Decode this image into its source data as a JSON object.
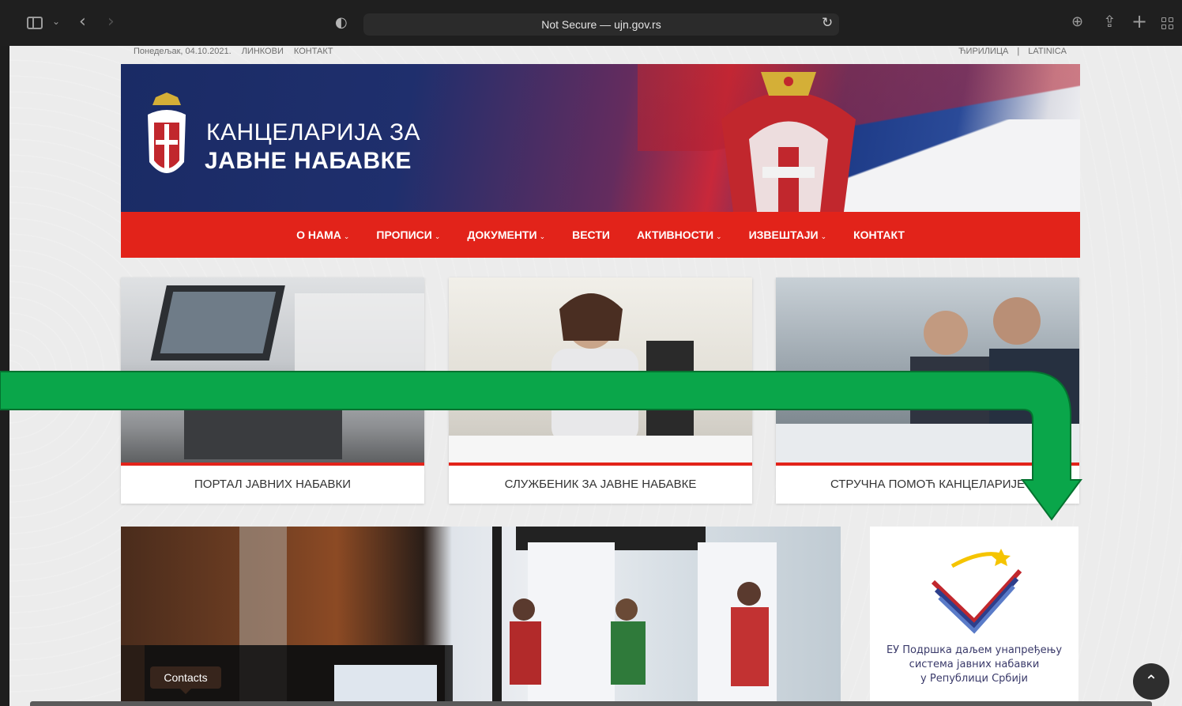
{
  "browser": {
    "address_text": "Not Secure — ujn.gov.rs"
  },
  "topbar": {
    "date": "Понедељак, 04.10.2021.",
    "links_label": "ЛИНКОВИ",
    "contact_label": "КОНТАКТ",
    "lang_cyrillic": "ЋИРИЛИЦА",
    "lang_sep": "|",
    "lang_latin": "LATINICA"
  },
  "header": {
    "title_line1": "КАНЦЕЛАРИЈА ЗА",
    "title_line2": "ЈАВНЕ НАБАВКЕ"
  },
  "nav": {
    "items": [
      {
        "label": "О НАМА",
        "dropdown": true
      },
      {
        "label": "ПРОПИСИ",
        "dropdown": true
      },
      {
        "label": "ДОКУМЕНТИ",
        "dropdown": true
      },
      {
        "label": "ВЕСТИ",
        "dropdown": false
      },
      {
        "label": "АКТИВНОСТИ",
        "dropdown": true
      },
      {
        "label": "ИЗВЕШТАЈИ",
        "dropdown": true
      },
      {
        "label": "КОНТАКТ",
        "dropdown": false
      }
    ],
    "caret": "⌄"
  },
  "cards": [
    {
      "label": "ПОРТАЛ ЈАВНИХ НАБАВКИ"
    },
    {
      "label": "СЛУЖБЕНИК ЗА ЈАВНЕ НАБАВКЕ"
    },
    {
      "label": "СТРУЧНА ПОМОЋ КАНЦЕЛАРИЈЕ"
    }
  ],
  "eu_box": {
    "line1": "ЕУ Подршка даљем унапређењу",
    "line2": "система јавних набавки",
    "line3": "у Републици Србији"
  },
  "tooltip": {
    "label": "Contacts"
  },
  "colors": {
    "nav_red": "#e2231a",
    "arrow_green": "#0aa64a",
    "banner_blue": "#1a2b65"
  }
}
